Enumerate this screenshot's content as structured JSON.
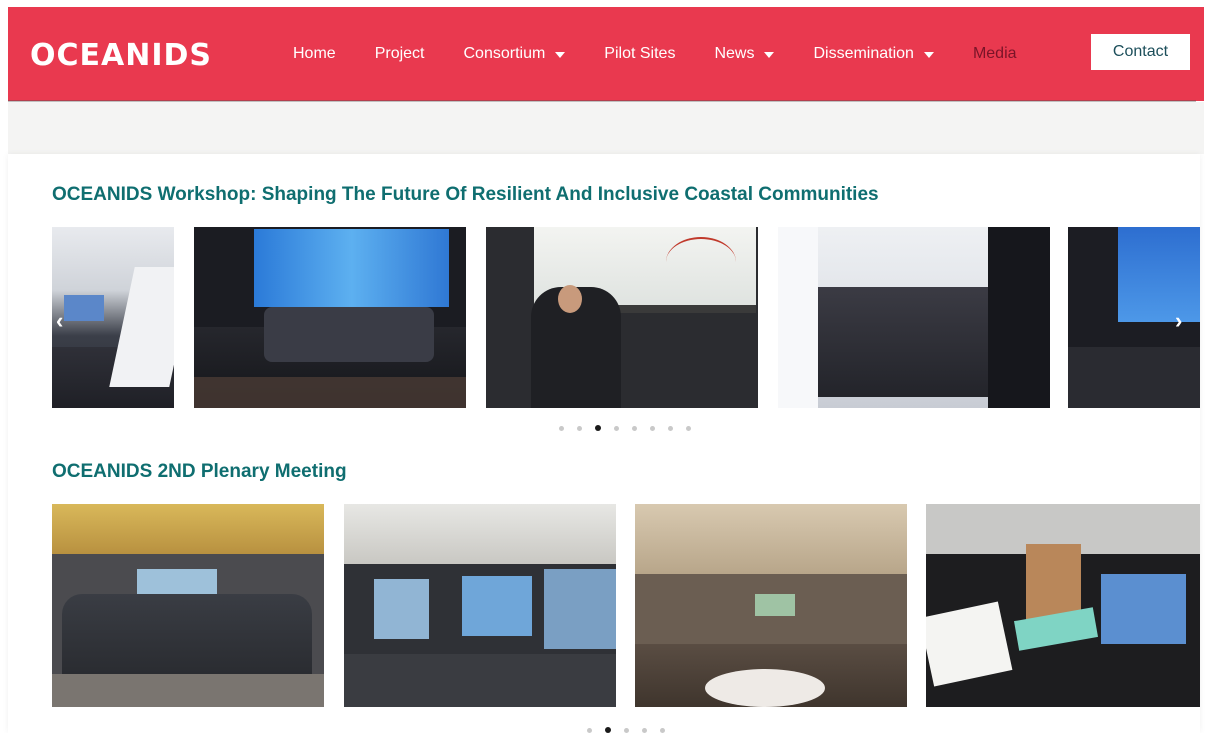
{
  "header": {
    "logo": "OCEANIDS",
    "nav": [
      {
        "label": "Home",
        "dropdown": false
      },
      {
        "label": "Project",
        "dropdown": false
      },
      {
        "label": "Consortium",
        "dropdown": true
      },
      {
        "label": "Pilot Sites",
        "dropdown": false
      },
      {
        "label": "News",
        "dropdown": true
      },
      {
        "label": "Dissemination",
        "dropdown": true
      },
      {
        "label": "Media",
        "dropdown": false
      }
    ],
    "contact_label": "Contact"
  },
  "colors": {
    "brand": "#e9394f",
    "title": "#0f6e70",
    "active_nav": "#7a1428"
  },
  "sections": [
    {
      "title": "OCEANIDS Workshop: Shaping The Future Of Resilient And Inclusive Coastal Communities",
      "dots_count": 8,
      "active_dot": 3
    },
    {
      "title": "OCEANIDS 2ND Plenary Meeting",
      "dots_count": 5,
      "active_dot": 2
    }
  ]
}
